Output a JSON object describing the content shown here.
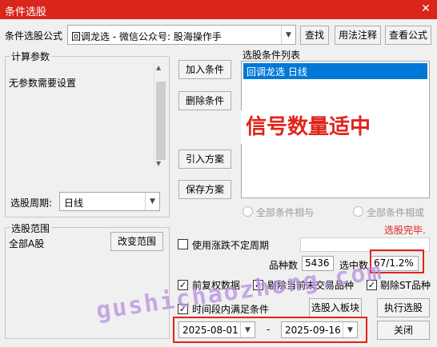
{
  "window": {
    "title": "条件选股"
  },
  "formula_row": {
    "label": "条件选股公式",
    "selected": "回调龙选  -  微信公众号: 股海操作手",
    "find": "查找",
    "usage": "用法注释",
    "view_formula": "查看公式"
  },
  "params": {
    "group_title": "计算参数",
    "empty_text": "无参数需要设置",
    "period_label": "选股周期:",
    "period_value": "日线"
  },
  "actions": {
    "add": "加入条件",
    "remove": "删除条件",
    "import": "引入方案",
    "save": "保存方案"
  },
  "conditions": {
    "title": "选股条件列表",
    "items": [
      "回调龙选  日线"
    ],
    "overlay_text": "信号数量适中",
    "radio_and": "全部条件相与",
    "radio_or": "全部条件相或"
  },
  "status": {
    "text": "选股完毕."
  },
  "range": {
    "group_title": "选股范围",
    "value": "全部A股",
    "change": "改变范围"
  },
  "options": {
    "unfixed_period": "使用涨跌不定周期",
    "count_label": "品种数",
    "count_value": "5436",
    "selected_label": "选中数",
    "selected_value": "67/1.2%",
    "pre_adjust": "前复权数据",
    "exclude_untraded": "剔除当前未交易品种",
    "exclude_st": "剔除ST品种",
    "time_range": "时间段内满足条件",
    "to_block": "选股入板块",
    "execute": "执行选股",
    "date_start": "2025-08-01",
    "date_sep": "-",
    "date_end": "2025-09-16",
    "close": "关闭"
  },
  "watermark": "gushichaozhong.com",
  "colors": {
    "titlebar": "#d9251c",
    "selection": "#0078d7",
    "highlight": "#e0241b",
    "status": "#e0241b"
  }
}
